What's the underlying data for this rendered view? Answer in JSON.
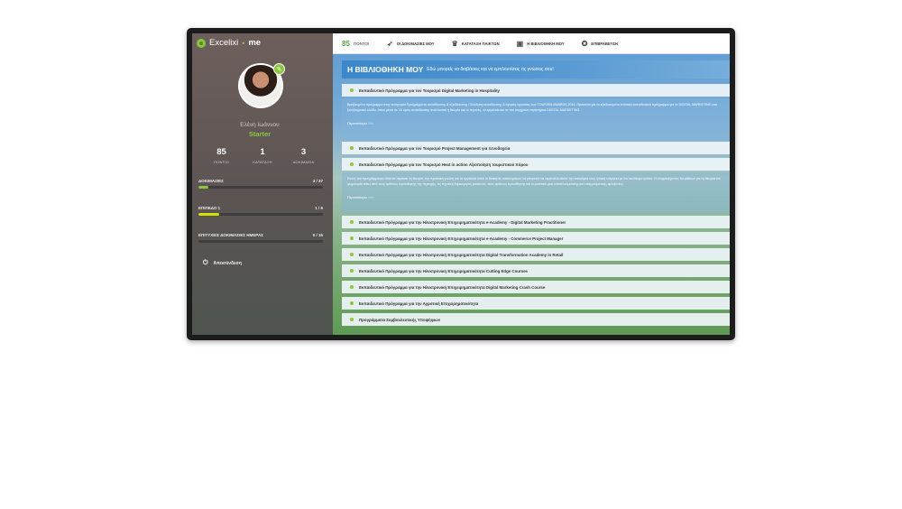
{
  "sidebar": {
    "logo": {
      "text": "Excelixi",
      "dot": "•",
      "suffix": "me"
    },
    "user": {
      "name": "Ελένη Ιωάννου",
      "rank": "Starter"
    },
    "stats": [
      {
        "value": "85",
        "label": "ΠΟΝΤΟΙ"
      },
      {
        "value": "1",
        "label": "ΚΑΤΑΤΑΞΗ"
      },
      {
        "value": "3",
        "label": "ΔΟΚΙΜΑΣΙΑ"
      }
    ],
    "progress": [
      {
        "label": "ΔΟΚΙΜΑΣΙΕΣ",
        "count": "3 / 37",
        "fraction": 0.081,
        "color": "#8cc63f"
      },
      {
        "label": "ΕΠΙΠΕΔΟ 1",
        "count": "1 / 6",
        "fraction": 0.167,
        "color": "#d4e000"
      },
      {
        "label": "ΕΠΙΤΥΧΕΙΣ ΔΟΚΙΜΑΣΙΕΣ ΗΜΕΡΑΣ",
        "count": "0 / 15",
        "fraction": 0.0,
        "color": "#8cc63f"
      }
    ],
    "logout": "Αποσύνδεση"
  },
  "nav": {
    "points_value": "85",
    "points_label": "ΠΟΝΤΟΙ",
    "items": [
      {
        "label": "ΟΙ ΔΟΚΙΜΑΣΙΕΣ ΜΟΥ",
        "icon": "rocket-icon"
      },
      {
        "label": "ΚΑΤΑΤΑΞΗ ΠΑΙΚΤΩΝ",
        "icon": "trophy-icon"
      },
      {
        "label": "Η ΒΙΒΛΙΟΘΗΚΗ ΜΟΥ",
        "icon": "library-icon"
      },
      {
        "label": "ΕΠΙΒΡΑΒΕΥΣΗ",
        "icon": "award-icon"
      }
    ]
  },
  "library": {
    "title": "Η ΒΙΒΛΙΟΘΗΚΗ ΜΟΥ",
    "subtitle": "Εδώ μπορείς να διαβάσεις και να εμπλουτίσεις τις γνώσεις σου!",
    "more_label": "Περισσότερα",
    "more_link": "Info",
    "courses": [
      {
        "title": "Εκπαιδευτικό Πρόγραμμα για τον Τουρισμό Digital Marketing in Hospitality",
        "description": "Βραβευμένο πρόγραμμα στην κατηγορία Προγράμματα εκπαίδευσης & εξειδίκευσης / Σύνδεση εκπαίδευσης & αγοράς εργασίας των TOURISM AWARDS 2016. Πρόκειται για το εξειδικευμένο εντατικό εκπαιδευτικό πρόγραμμα για το DIGITAL MARKETING στο ξενοδοχειακό κλάδο, όπου μέσα σε 16 ώρες εκπαίδευσης αναλύονται η θεωρία και οι τεχνικές, τα εργαλεία και τα πιο σύγχρονα στρατηγικά DIGITAL MARKETING."
      },
      {
        "title": "Εκπαιδευτικό Πρόγραμμα για τον Τουρισμό Project Management για Ξενοδοχεία",
        "description": ""
      },
      {
        "title": "Εκπαιδευτικό Πρόγραμμα για τον Τουρισμό Heat in action Αξιοποίηση τουριστικού πόρου",
        "description": "Εκτός του προγράμματος είναι να περάσει τη θεωρία, την πρακτική γνώση και τα εργαλεία ώστε οι διοικητές καταλυμάτων να μπορούν να εκμεταλλευθούν την καινούρια τους ζωτική ενέργεια με τον καλύτερο τρόπο. Οι συμμετέχοντες θα μάθουν για τη θεωρία και ψυχολογία πίσω από τους τρόπους προώθησης της περιοχής, τις τεχνικές δημιουργίας ρουτινών, τους τρόπους προώθησης και τα μυστικά μιας αποτελεσματικής και επαγγελματικής φιλοξενίας."
      },
      {
        "title": "Εκπαιδευτικό Πρόγραμμα για την Ηλεκτρονική Επιχειρηματικότητα e-Academy - Digital Marketing Practitioner",
        "description": ""
      },
      {
        "title": "Εκπαιδευτικό Πρόγραμμα για την Ηλεκτρονική Επιχειρηματικότητα e-Academy - Commerce Project Manager",
        "description": ""
      },
      {
        "title": "Εκπαιδευτικό Πρόγραμμα για την Ηλεκτρονική Επιχειρηματικότητα Digital Transformation Academy in Retail",
        "description": ""
      },
      {
        "title": "Εκπαιδευτικό Πρόγραμμα για την Ηλεκτρονική Επιχειρηματικότητα Cutting Edge Courses",
        "description": ""
      },
      {
        "title": "Εκπαιδευτικό Πρόγραμμα για την Ηλεκτρονική Επιχειρηματικότητα Digital Marketing Crash Course",
        "description": ""
      },
      {
        "title": "Εκπαιδευτικό Πρόγραμμα για την Αγροτική Επιχειρηματικότητα",
        "description": ""
      },
      {
        "title": "Προγράμματα Συμβουλευτικής Υποψήφιων",
        "description": ""
      }
    ]
  },
  "colors": {
    "accent_green": "#8cc63f",
    "header_blue": "#3b87c9",
    "sidebar_bg": "#5b5453"
  }
}
